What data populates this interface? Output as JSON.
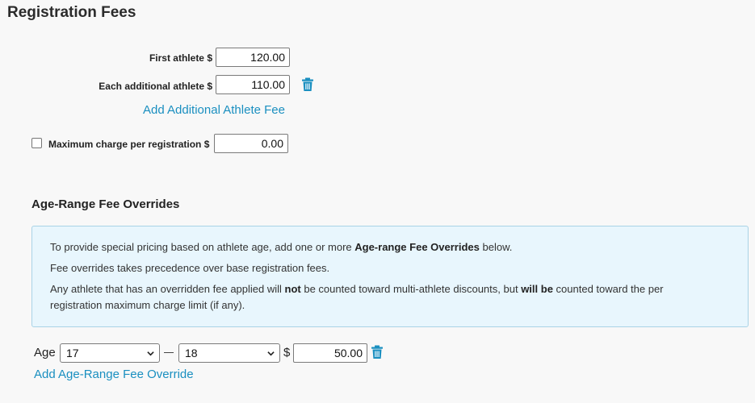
{
  "page": {
    "title": "Registration Fees"
  },
  "fees": {
    "first_athlete": {
      "label": "First athlete $",
      "value": "120.00"
    },
    "additional_athlete": {
      "label": "Each additional athlete $",
      "value": "110.00"
    },
    "add_fee_link": "Add Additional Athlete Fee",
    "max_charge": {
      "label": "Maximum charge per registration $",
      "value": "0.00",
      "checked": false
    }
  },
  "overrides": {
    "title": "Age-Range Fee Overrides",
    "info": {
      "line1_pre": "To provide special pricing based on athlete age, add one or more ",
      "line1_bold": "Age-range Fee Overrides",
      "line1_post": " below.",
      "line2": "Fee overrides takes precedence over base registration fees.",
      "line3_pre": "Any athlete that has an overridden fee applied will ",
      "line3_bold1": "not",
      "line3_mid": " be counted toward multi-athlete discounts, but ",
      "line3_bold2": "will be",
      "line3_post": " counted toward the per",
      "line4": "registration maximum charge limit (if any)."
    },
    "row": {
      "age_label": "Age",
      "min_age": "17",
      "max_age": "18",
      "currency": "$",
      "amount": "50.00"
    },
    "add_override_link": "Add Age-Range Fee Override"
  },
  "colors": {
    "link": "#1a8fc0",
    "info_bg": "#e8f6fd",
    "info_border": "#a9d3e6",
    "page_bg": "#f8f8f8"
  },
  "icons": {
    "delete": "trash-icon",
    "dropdown": "chevron-down-icon"
  }
}
